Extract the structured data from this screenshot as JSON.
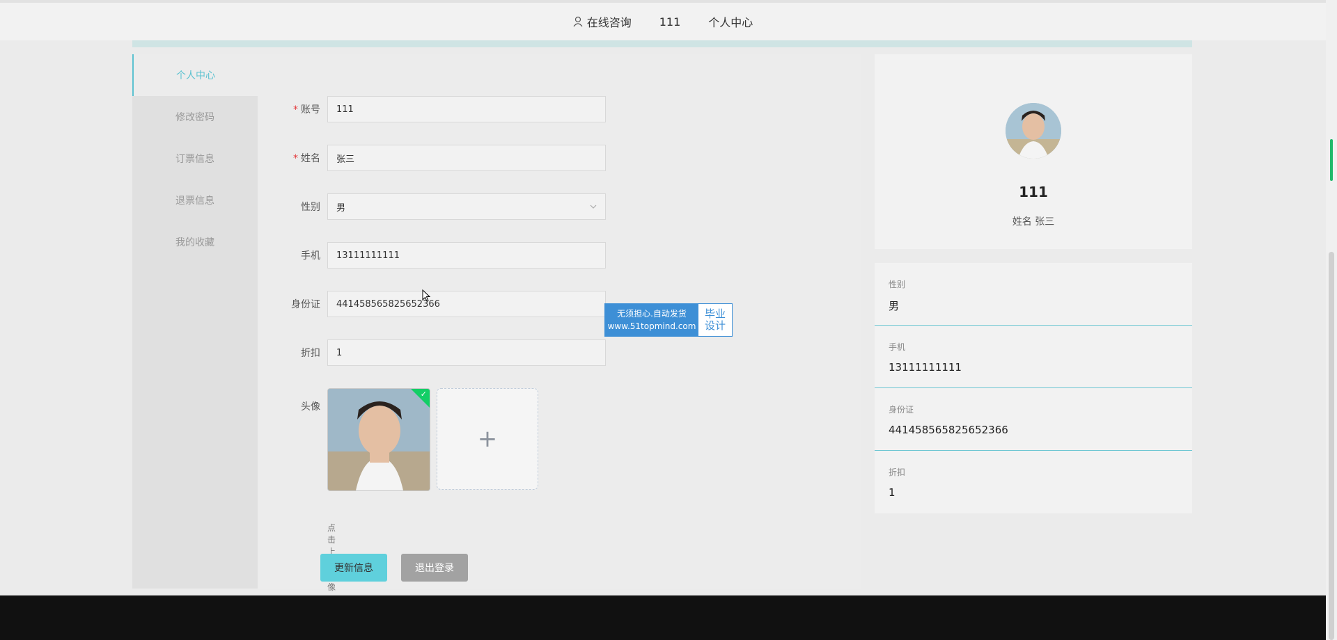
{
  "header": {
    "nav_consult": "在线咨询",
    "nav_user": "111",
    "nav_center": "个人中心"
  },
  "sidemenu": {
    "items": [
      "个人中心",
      "修改密码",
      "订票信息",
      "退票信息",
      "我的收藏"
    ]
  },
  "form": {
    "account_label": "账号",
    "account_value": "111",
    "name_label": "姓名",
    "name_value": "张三",
    "gender_label": "性别",
    "gender_value": "男",
    "phone_label": "手机",
    "phone_value": "13111111111",
    "id_label": "身份证",
    "id_value": "441458565825652366",
    "discount_label": "折扣",
    "discount_value": "1",
    "avatar_label": "头像",
    "upload_tip": "点击上传头像",
    "upload_plus": "+",
    "update_button": "更新信息",
    "logout_button": "退出登录"
  },
  "watermark": {
    "line1": "无须担心.自动发货",
    "line2": "www.51topmind.com",
    "right1": "毕业",
    "right2": "设计"
  },
  "profile": {
    "username": "111",
    "realname": "姓名 张三"
  },
  "info": [
    {
      "key": "性别",
      "value": "男"
    },
    {
      "key": "手机",
      "value": "13111111111"
    },
    {
      "key": "身份证",
      "value": "441458565825652366"
    },
    {
      "key": "折扣",
      "value": "1"
    }
  ],
  "colors": {
    "accent": "#5cc2d0",
    "required": "#e4393c",
    "update_button": "#5fd0dc",
    "logout_button": "#a2a2a2"
  }
}
